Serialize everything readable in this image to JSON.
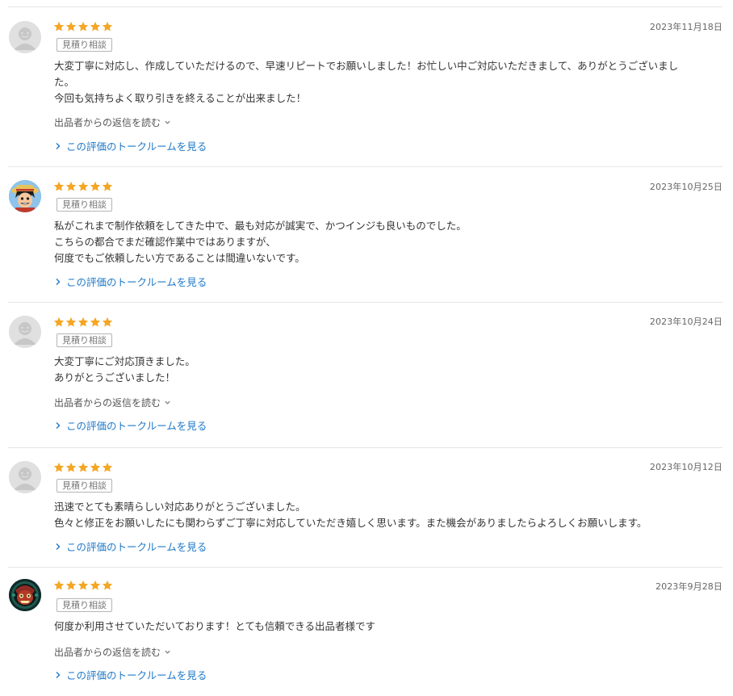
{
  "reviews": [
    {
      "avatar": "default-avatar-icon",
      "stars": 5,
      "date": "2023年11月18日",
      "tag": "見積り相談",
      "text": "大変丁寧に対応し、作成していただけるので、早速リピートでお願いしました！お忙しい中ご対応いただきまして、ありがとうございまし\nた。\n今回も気持ちよく取り引きを終えることが出来ました！",
      "reply_label": "出品者からの返信を読む",
      "talk_label": "この評価のトークルームを見る"
    },
    {
      "avatar": "pirate-boy-avatar",
      "stars": 5,
      "date": "2023年10月25日",
      "tag": "見積り相談",
      "text": "私がこれまで制作依頼をしてきた中で、最も対応が誠実で、かつインジも良いものでした。\nこちらの都合でまだ確認作業中ではありますが、\n何度でもご依頼したい方であることは間違いないです。",
      "reply_label": "",
      "talk_label": "この評価のトークルームを見る"
    },
    {
      "avatar": "default-avatar-icon",
      "stars": 5,
      "date": "2023年10月24日",
      "tag": "見積り相談",
      "text": "大変丁寧にご対応頂きました。\nありがとうございました！",
      "reply_label": "出品者からの返信を読む",
      "talk_label": "この評価のトークルームを見る"
    },
    {
      "avatar": "default-avatar-icon",
      "stars": 5,
      "date": "2023年10月12日",
      "tag": "見積り相談",
      "text": "迅速でとても素晴らしい対応ありがとうございました。\n色々と修正をお願いしたにも関わらずご丁寧に対応していただき嬉しく思います。また機会がありましたらよろしくお願いします。",
      "reply_label": "",
      "talk_label": "この評価のトークルームを見る"
    },
    {
      "avatar": "mask-character-avatar",
      "stars": 5,
      "date": "2023年9月28日",
      "tag": "見積り相談",
      "text": "何度か利用させていただいております！とても信頼できる出品者様です",
      "reply_label": "出品者からの返信を読む",
      "talk_label": "この評価のトークルームを見る"
    }
  ],
  "colors": {
    "star": "#f5a623",
    "link": "#1e78c8",
    "divider": "#e6e6e6"
  }
}
